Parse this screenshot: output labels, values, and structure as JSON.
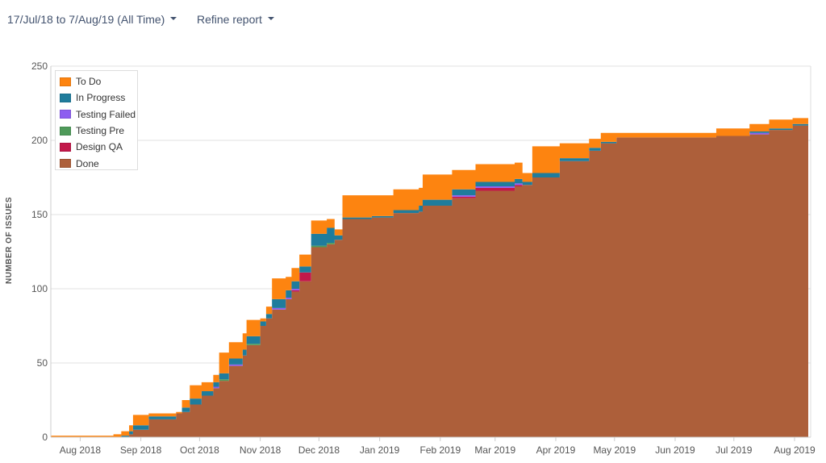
{
  "header": {
    "date_range_label": "17/Jul/18 to 7/Aug/19 (All Time)",
    "refine_label": "Refine report"
  },
  "chart_data": {
    "type": "area",
    "stacked": true,
    "step": true,
    "start_date": "17/Jul/18",
    "end_date": "7/Aug/19",
    "x_unit": "days since start date",
    "ylabel": "NUMBER OF ISSUES",
    "xlabel": "",
    "ylim": [
      0,
      250
    ],
    "yticks": [
      0,
      50,
      100,
      150,
      200,
      250
    ],
    "xlim": [
      0,
      387
    ],
    "xticks": [
      {
        "label": "Aug 2018",
        "day": 15
      },
      {
        "label": "Sep 2018",
        "day": 46
      },
      {
        "label": "Oct 2018",
        "day": 76
      },
      {
        "label": "Nov 2018",
        "day": 107
      },
      {
        "label": "Dec 2018",
        "day": 137
      },
      {
        "label": "Jan 2019",
        "day": 168
      },
      {
        "label": "Feb 2019",
        "day": 199
      },
      {
        "label": "Mar 2019",
        "day": 227
      },
      {
        "label": "Apr 2019",
        "day": 258
      },
      {
        "label": "May 2019",
        "day": 288
      },
      {
        "label": "Jun 2019",
        "day": 319
      },
      {
        "label": "Jul 2019",
        "day": 349
      },
      {
        "label": "Aug 2019",
        "day": 380
      }
    ],
    "grid": true,
    "legend_placement": "top-left",
    "legend": [
      "To Do",
      "In Progress",
      "Testing Failed",
      "Testing Pre",
      "Design QA",
      "Done"
    ],
    "stack_order_bottom_to_top": [
      "Done",
      "Design QA",
      "Testing Pre",
      "Testing Failed",
      "In Progress",
      "To Do"
    ],
    "colors": {
      "To Do": "#fd8410",
      "In Progress": "#1f7c9c",
      "Testing Failed": "#8d5ef0",
      "Testing Pre": "#4f9a5a",
      "Design QA": "#c2184a",
      "Done": "#ad5f3a"
    },
    "x": [
      0,
      32,
      36,
      40,
      42,
      50,
      64,
      67,
      71,
      77,
      83,
      86,
      91,
      98,
      100,
      107,
      110,
      113,
      120,
      123,
      127,
      133,
      141,
      145,
      149,
      164,
      175,
      188,
      190,
      205,
      217,
      237,
      241,
      246,
      260,
      275,
      281,
      289,
      340,
      357,
      367,
      379,
      387
    ],
    "series": [
      {
        "name": "Done",
        "values": [
          0,
          0,
          0,
          2,
          5,
          12,
          16,
          17,
          22,
          28,
          33,
          38,
          48,
          55,
          62,
          75,
          80,
          86,
          93,
          98,
          105,
          128,
          130,
          133,
          147,
          148,
          151,
          152,
          156,
          161,
          166,
          169,
          170,
          175,
          186,
          193,
          198,
          202,
          203,
          204,
          207,
          210,
          210
        ]
      },
      {
        "name": "Design QA",
        "values": [
          0,
          0,
          0,
          0,
          0,
          0,
          0,
          0,
          0,
          0,
          0,
          0,
          0,
          0,
          0,
          0,
          0,
          0,
          0,
          1,
          6,
          0,
          0,
          0,
          0,
          0,
          0,
          0,
          0,
          1,
          2,
          1,
          0,
          0,
          0,
          0,
          0,
          0,
          0,
          0,
          0,
          0,
          0
        ]
      },
      {
        "name": "Testing Pre",
        "values": [
          0,
          0,
          0,
          0,
          0,
          0,
          0,
          0,
          0,
          0,
          0,
          1,
          0,
          0,
          1,
          0,
          0,
          0,
          0,
          0,
          0,
          1,
          1,
          0,
          0,
          0,
          0,
          0,
          0,
          0,
          0,
          0,
          0,
          0,
          0,
          0,
          0,
          0,
          0,
          0,
          0,
          0,
          0
        ]
      },
      {
        "name": "Testing Failed",
        "values": [
          0,
          0,
          0,
          0,
          0,
          0,
          0,
          0,
          0,
          0,
          1,
          0,
          1,
          0,
          0,
          0,
          0,
          1,
          1,
          1,
          0,
          0,
          0,
          0,
          0,
          0,
          0,
          0,
          0,
          1,
          1,
          1,
          0,
          0,
          0,
          0,
          0,
          0,
          0,
          1,
          0,
          0,
          0
        ]
      },
      {
        "name": "In Progress",
        "values": [
          0,
          0,
          1,
          2,
          3,
          2,
          0,
          3,
          4,
          3,
          3,
          4,
          4,
          4,
          5,
          3,
          3,
          6,
          5,
          5,
          4,
          8,
          10,
          3,
          1,
          1,
          2,
          4,
          4,
          4,
          3,
          3,
          2,
          3,
          2,
          2,
          1,
          0,
          0,
          1,
          1,
          1,
          1
        ]
      },
      {
        "name": "To Do",
        "values": [
          1,
          2,
          3,
          4,
          7,
          2,
          1,
          5,
          9,
          6,
          5,
          14,
          11,
          11,
          11,
          2,
          5,
          14,
          9,
          9,
          8,
          9,
          6,
          4,
          15,
          14,
          14,
          12,
          17,
          13,
          12,
          11,
          6,
          18,
          10,
          6,
          6,
          3,
          5,
          5,
          6,
          4,
          4
        ]
      }
    ]
  }
}
